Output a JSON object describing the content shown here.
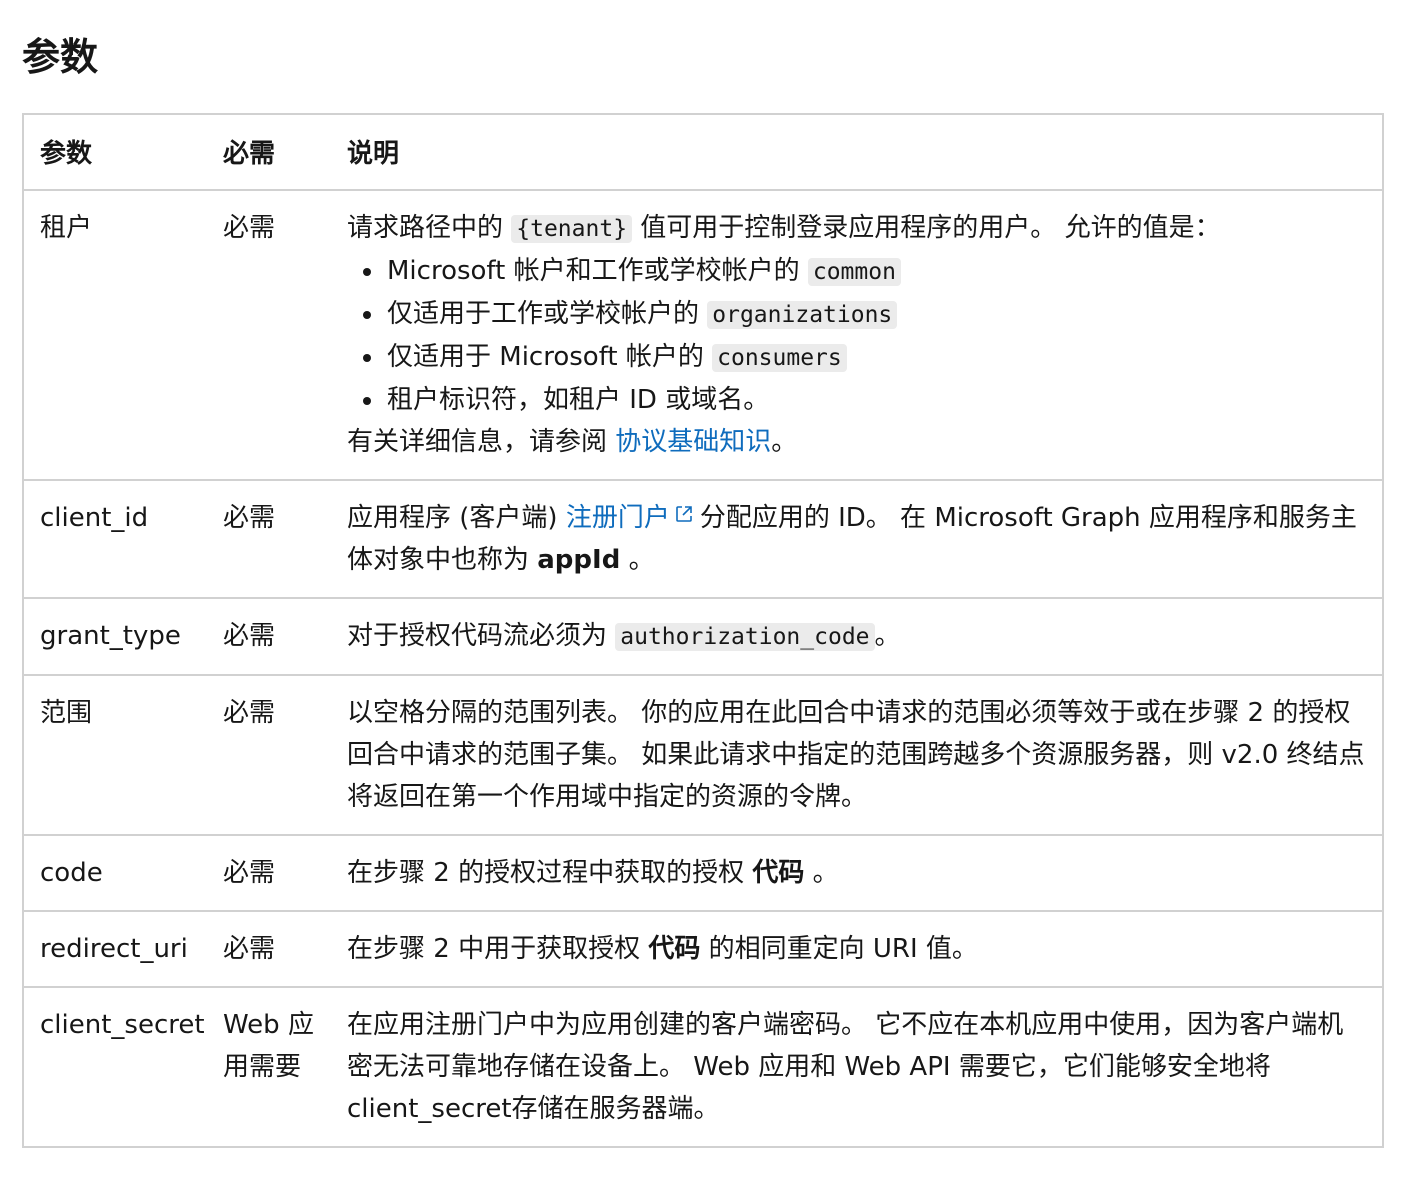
{
  "page": {
    "title": "参数"
  },
  "table": {
    "headers": {
      "param": "参数",
      "required": "必需",
      "description": "说明"
    },
    "rows": {
      "tenant": {
        "param": "租户",
        "required": "必需",
        "desc_before": "请求路径中的 ",
        "desc_code": "{tenant}",
        "desc_after": " 值可用于控制登录应用程序的用户。 允许的值是：",
        "items": [
          {
            "text": "Microsoft 帐户和工作或学校帐户的 ",
            "code": "common"
          },
          {
            "text": "仅适用于工作或学校帐户的 ",
            "code": "organizations"
          },
          {
            "text": "仅适用于 Microsoft 帐户的 ",
            "code": "consumers"
          },
          {
            "text": "租户标识符，如租户 ID 或域名。",
            "code": ""
          }
        ],
        "more_before": "有关详细信息，请参阅 ",
        "more_link": "协议基础知识",
        "more_after": "。"
      },
      "client_id": {
        "param": "client_id",
        "required": "必需",
        "desc_before": "应用程序 (客户端) ",
        "desc_link": "注册门户",
        "desc_after": "分配应用的 ID。 在 Microsoft Graph 应用程序和服务主体对象中也称为 ",
        "desc_bold": "appId",
        "desc_end": " 。"
      },
      "grant_type": {
        "param": "grant_type",
        "required": "必需",
        "desc_before": "对于授权代码流必须为 ",
        "desc_code": "authorization_code",
        "desc_after": "。"
      },
      "scope": {
        "param": "范围",
        "required": "必需",
        "desc": "以空格分隔的范围列表。 你的应用在此回合中请求的范围必须等效于或在步骤 2 的授权回合中请求的范围子集。 如果此请求中指定的范围跨越多个资源服务器，则 v2.0 终结点将返回在第一个作用域中指定的资源的令牌。"
      },
      "code": {
        "param": "code",
        "required": "必需",
        "desc_before": "在步骤 2 的授权过程中获取的授权 ",
        "desc_bold": "代码",
        "desc_after": " 。"
      },
      "redirect_uri": {
        "param": "redirect_uri",
        "required": "必需",
        "desc_before": "在步骤 2 中用于获取授权 ",
        "desc_bold": "代码",
        "desc_after": " 的相同重定向 URI 值。"
      },
      "client_secret": {
        "param": "client_secret",
        "required": "Web 应用需要",
        "desc": "在应用注册门户中为应用创建的客户端密码。 它不应在本机应用中使用，因为客户端机密无法可靠地存储在设备上。 Web 应用和 Web API 需要它，它们能够安全地将client_secret存储在服务器端。"
      }
    }
  },
  "colors": {
    "link": "#0f6cbd",
    "border": "#d1d1d1",
    "code_bg": "#ebebeb",
    "text": "#171717"
  },
  "icons": {
    "external_link": "external-link-icon"
  }
}
